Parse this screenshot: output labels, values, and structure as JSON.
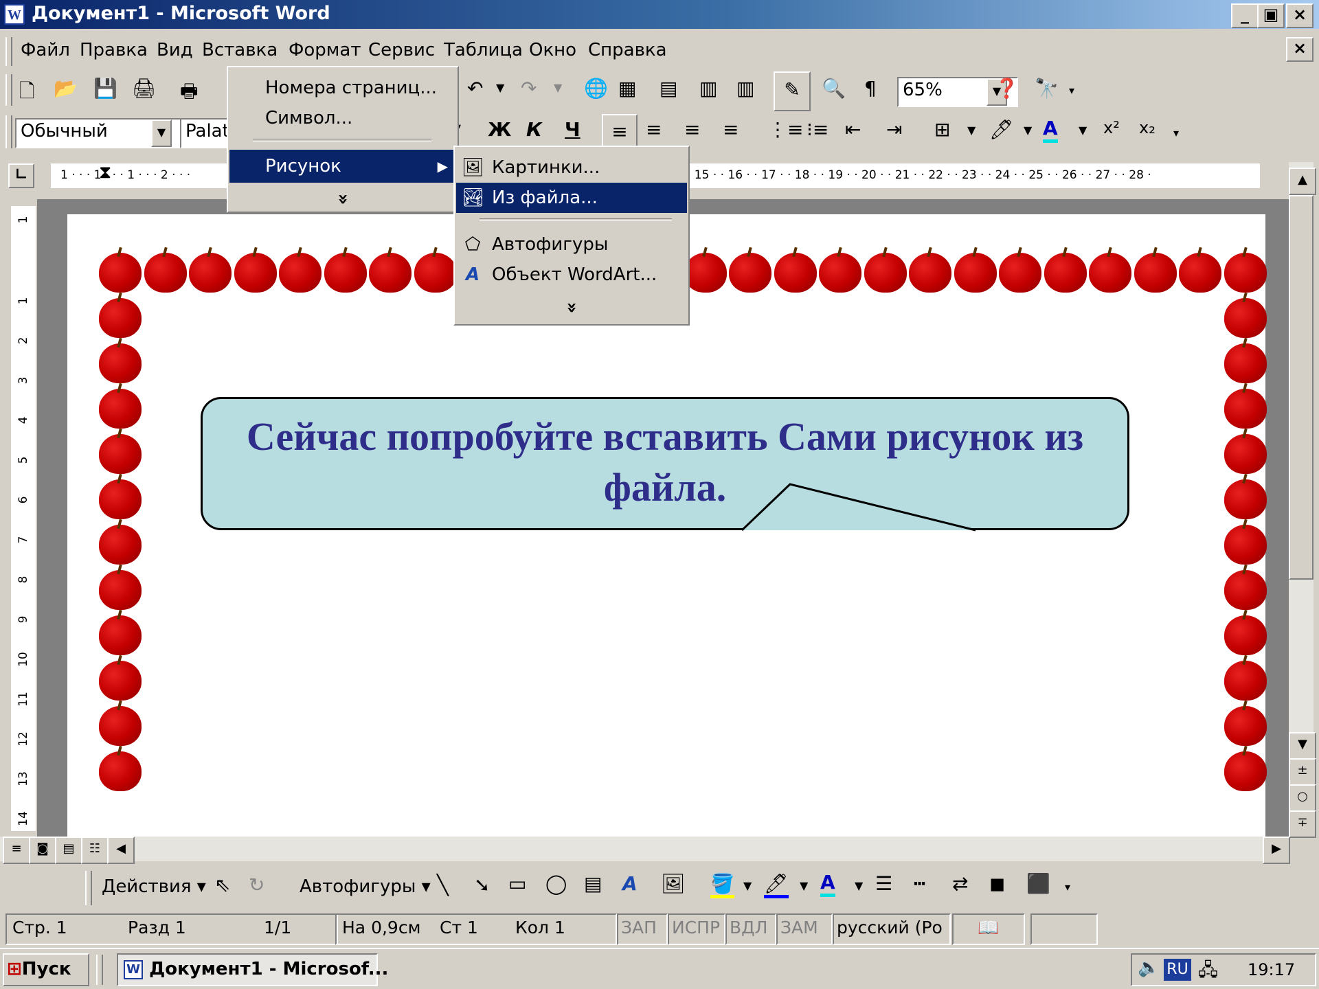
{
  "window": {
    "title": "Документ1 - Microsoft Word",
    "app_icon": "word-icon",
    "caption_buttons": [
      "_",
      "🗗",
      "×"
    ]
  },
  "menubar": {
    "items": [
      "Файл",
      "Правка",
      "Вид",
      "Вставка",
      "Формат",
      "Сервис",
      "Таблица",
      "Окно",
      "Справка"
    ],
    "close": "×"
  },
  "standard_toolbar": {
    "zoom": "65%"
  },
  "formatting_toolbar": {
    "style": "Обычный",
    "font": "Palati",
    "bold": "Ж",
    "italic": "К",
    "underline": "Ч"
  },
  "insert_menu": {
    "items": [
      "Номера страниц...",
      "Символ...",
      "Рисунок"
    ],
    "expand": "»"
  },
  "picture_submenu": {
    "items": [
      "Картинки...",
      "Из файла...",
      "Автофигуры",
      "Объект WordArt..."
    ],
    "selected": "Из файла...",
    "expand": "»"
  },
  "ruler": {
    "horizontal": "1 · · · 1 · · · 1 · · · 2 · · ·",
    "horizontal_right": "· 15 · · 16 · · 17 · · 18 · · 19 · · 20 · · 21 · · 22 · · 23 · · 24 · · 25 · · 26 · · 27 · · 28 ·",
    "vertical": [
      "1",
      "1",
      "2",
      "3",
      "4",
      "5",
      "6",
      "7",
      "8",
      "9",
      "10",
      "11",
      "12",
      "13",
      "14"
    ]
  },
  "document": {
    "callout_text": "Сейчас попробуйте вставить Сами рисунок из файла."
  },
  "drawing_toolbar": {
    "actions": "Действия",
    "autoshapes": "Автофигуры"
  },
  "statusbar": {
    "page": "Стр. 1",
    "section": "Разд 1",
    "pages": "1/1",
    "position": "На 0,9см",
    "line": "Ст 1",
    "column": "Кол 1",
    "rec": "ЗАП",
    "trk": "ИСПР",
    "ext": "ВДЛ",
    "ovr": "ЗАМ",
    "language": "русский (Ро"
  },
  "taskbar": {
    "start": "Пуск",
    "task": "Документ1 - Microsof...",
    "lang": "RU",
    "time": "19:17"
  }
}
